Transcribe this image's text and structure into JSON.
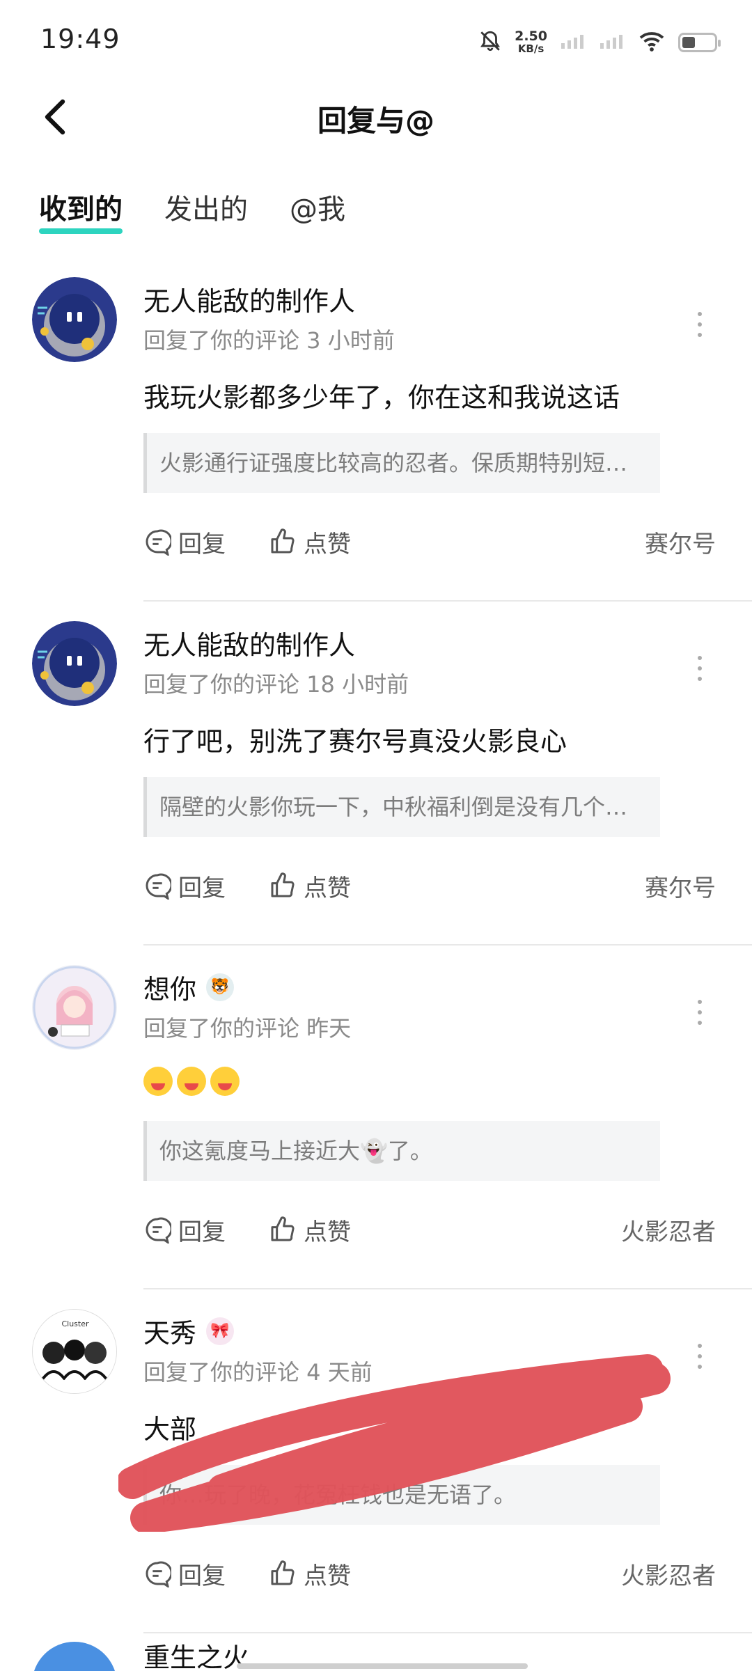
{
  "status": {
    "time": "19:49",
    "speed_value": "2.50",
    "speed_unit": "KB/s"
  },
  "header": {
    "title": "回复与@"
  },
  "tabs": [
    {
      "label": "收到的",
      "active": true
    },
    {
      "label": "发出的",
      "active": false
    },
    {
      "label": "@我",
      "active": false
    }
  ],
  "comments": [
    {
      "name": "无人能敌的制作人",
      "meta": "回复了你的评论 3 小时前",
      "text": "我玩火影都多少年了，你在这和我说这话",
      "quote": "火影通行证强度比较高的忍者。保质期特别短…",
      "reply": "回复",
      "like": "点赞",
      "tag": "赛尔号"
    },
    {
      "name": "无人能敌的制作人",
      "meta": "回复了你的评论 18 小时前",
      "text": "行了吧，别洗了赛尔号真没火影良心",
      "quote": "隔壁的火影你玩一下，中秋福利倒是没有几个…",
      "reply": "回复",
      "like": "点赞",
      "tag": "赛尔号"
    },
    {
      "name": "想你",
      "meta": "回复了你的评论  昨天",
      "text": "",
      "quote": "你这氪度马上接近大👻了。",
      "reply": "回复",
      "like": "点赞",
      "tag": "火影忍者"
    },
    {
      "name": "天秀",
      "meta": "回复了你的评论 4 天前",
      "text": "大部",
      "quote": "你…玩了晚，花冤枉钱也是无语了。",
      "reply": "回复",
      "like": "点赞",
      "tag": "火影忍者"
    }
  ],
  "partial_item": {
    "name": "重生之火"
  },
  "colors": {
    "tab_underline": "#2dd4bf",
    "scribble": "#e0535a"
  }
}
